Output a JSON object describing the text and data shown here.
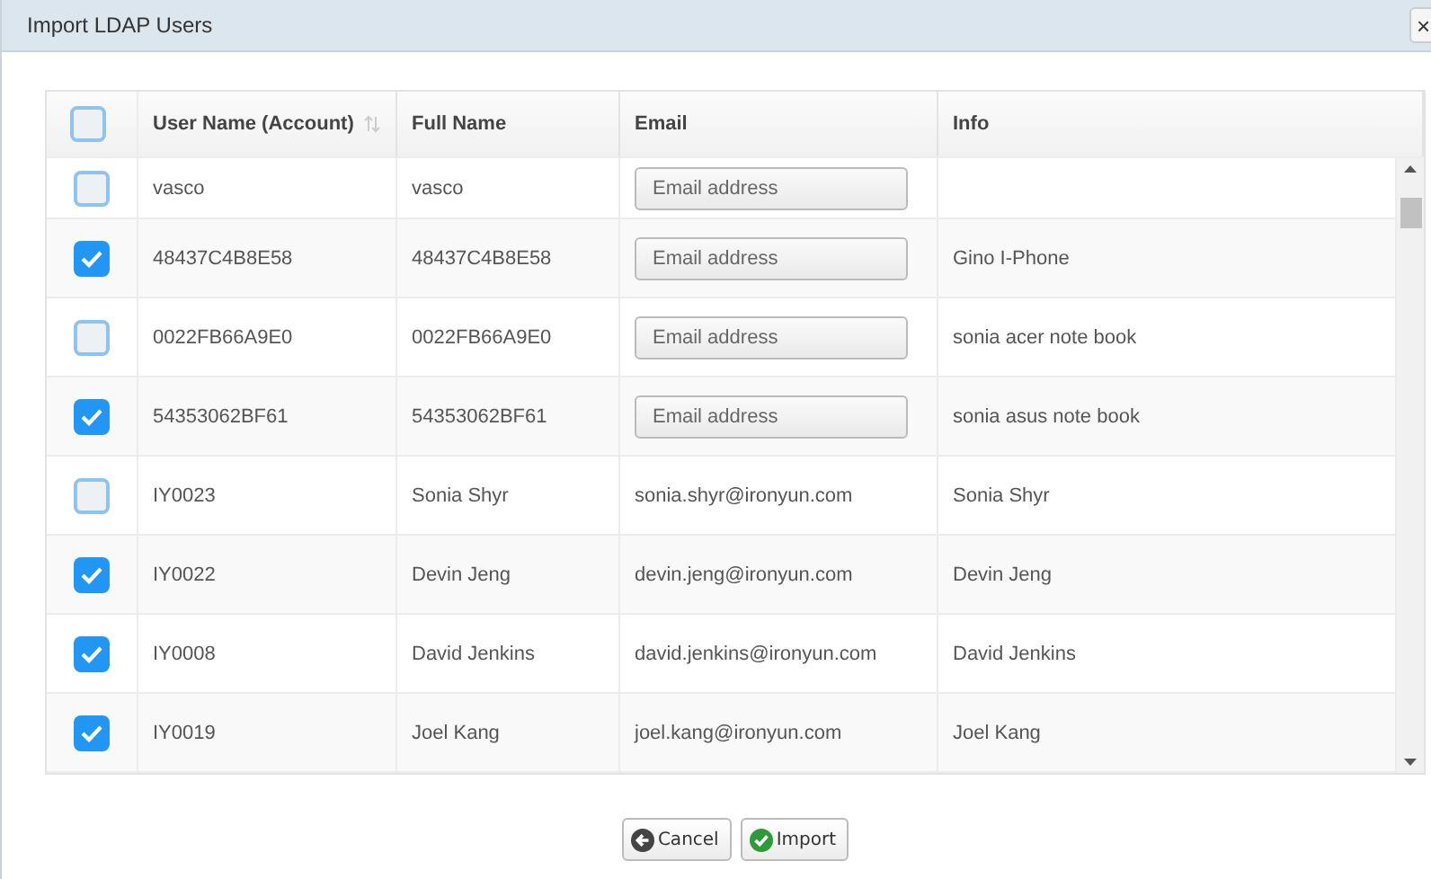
{
  "window": {
    "title": "Import LDAP Users",
    "close": "×"
  },
  "table": {
    "select_all": {
      "checked": false
    },
    "columns": [
      {
        "label": "User Name (Account)",
        "sortable": true
      },
      {
        "label": "Full Name",
        "sortable": false
      },
      {
        "label": "Email",
        "sortable": false
      },
      {
        "label": "Info",
        "sortable": false
      }
    ],
    "rows": [
      {
        "checked": false,
        "account": "vasco",
        "full_name": "vasco",
        "email": {
          "kind": "field",
          "placeholder": "Email address"
        },
        "info": ""
      },
      {
        "checked": true,
        "account": "48437C4B8E58",
        "full_name": "48437C4B8E58",
        "email": {
          "kind": "field",
          "placeholder": "Email address"
        },
        "info": "Gino I-Phone"
      },
      {
        "checked": false,
        "account": "0022FB66A9E0",
        "full_name": "0022FB66A9E0",
        "email": {
          "kind": "field",
          "placeholder": "Email address"
        },
        "info": "sonia acer note book"
      },
      {
        "checked": true,
        "account": "54353062BF61",
        "full_name": "54353062BF61",
        "email": {
          "kind": "field",
          "placeholder": "Email address"
        },
        "info": "sonia asus note book"
      },
      {
        "checked": false,
        "account": "IY0023",
        "full_name": "Sonia Shyr",
        "email": {
          "kind": "text",
          "value": "sonia.shyr@ironyun.com"
        },
        "info": "Sonia Shyr"
      },
      {
        "checked": true,
        "account": "IY0022",
        "full_name": "Devin Jeng",
        "email": {
          "kind": "text",
          "value": "devin.jeng@ironyun.com"
        },
        "info": "Devin Jeng"
      },
      {
        "checked": true,
        "account": "IY0008",
        "full_name": "David Jenkins",
        "email": {
          "kind": "text",
          "value": "david.jenkins@ironyun.com"
        },
        "info": "David Jenkins"
      },
      {
        "checked": true,
        "account": "IY0019",
        "full_name": "Joel Kang",
        "email": {
          "kind": "text",
          "value": "joel.kang@ironyun.com"
        },
        "info": "Joel Kang"
      }
    ]
  },
  "buttons": [
    {
      "kind": "cancel",
      "label": "Cancel"
    },
    {
      "kind": "import",
      "label": "Import"
    }
  ]
}
